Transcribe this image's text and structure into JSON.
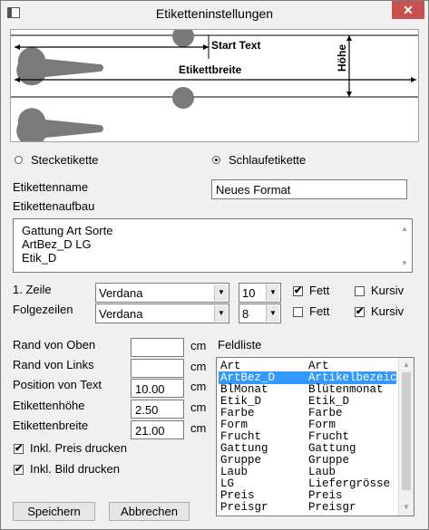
{
  "window": {
    "title": "Etiketteninstellungen",
    "close_glyph": "✕"
  },
  "preview": {
    "start_text": "Start Text",
    "etikettbreite": "Etikettbreite",
    "hoehe": "Höhe"
  },
  "type": {
    "stecketikette": "Stecketikette",
    "schlaufetikette": "Schlaufetikette",
    "selected": "Schlaufetikette"
  },
  "etikettenname": {
    "label": "Etikettenname",
    "value": "Neues Format"
  },
  "etikettenaufbau": {
    "label": "Etikettenaufbau",
    "lines": [
      "Gattung Art Sorte",
      "ArtBez_D LG",
      "Etik_D"
    ]
  },
  "zeile1": {
    "label": "1. Zeile",
    "font": "Verdana",
    "size": "10",
    "fett_label": "Fett",
    "fett": true,
    "kursiv_label": "Kursiv",
    "kursiv": false
  },
  "folgezeilen": {
    "label": "Folgezeilen",
    "font": "Verdana",
    "size": "8",
    "fett_label": "Fett",
    "fett": false,
    "kursiv_label": "Kursiv",
    "kursiv": true
  },
  "fields": {
    "rand_oben": {
      "label": "Rand von Oben",
      "value": "",
      "unit": "cm"
    },
    "rand_links": {
      "label": "Rand von Links",
      "value": "",
      "unit": "cm"
    },
    "position_text": {
      "label": "Position von Text",
      "value": "10.00",
      "unit": "cm"
    },
    "etikettenhoehe": {
      "label": "Etikettenhöhe",
      "value": "2.50",
      "unit": "cm"
    },
    "etikettenbreite": {
      "label": "Etikettenbreite",
      "value": "21.00",
      "unit": "cm"
    }
  },
  "options": {
    "preis": {
      "label": "Inkl. Preis drucken",
      "checked": true
    },
    "bild": {
      "label": "Inkl. Bild drucken",
      "checked": true
    }
  },
  "feldliste": {
    "label": "Feldliste",
    "rows": [
      [
        "Art",
        "Art"
      ],
      [
        "ArtBez_D",
        "Artikelbezeich"
      ],
      [
        "BlMonat",
        "Blütenmonat"
      ],
      [
        "Etik_D",
        "Etik_D"
      ],
      [
        "Farbe",
        "Farbe"
      ],
      [
        "Form",
        "Form"
      ],
      [
        "Frucht",
        "Frucht"
      ],
      [
        "Gattung",
        "Gattung"
      ],
      [
        "Gruppe",
        "Gruppe"
      ],
      [
        "Laub",
        "Laub"
      ],
      [
        "LG",
        "Liefergrösse"
      ],
      [
        "Preis",
        "Preis"
      ],
      [
        "Preisgr",
        "Preisgr"
      ]
    ],
    "selected_index": 1
  },
  "buttons": {
    "save": "Speichern",
    "cancel": "Abbrechen"
  },
  "glyphs": {
    "check": "✔",
    "dropdown": "▼",
    "scroll_up": "▲",
    "scroll_down": "▼"
  }
}
